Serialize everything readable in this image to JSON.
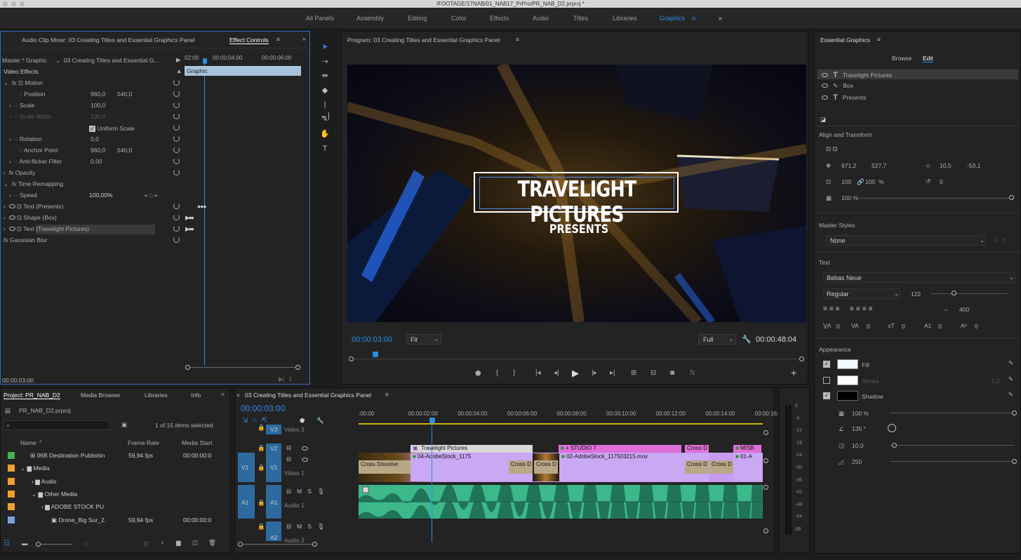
{
  "titlebar": {
    "title": "/FOOTAGE/17NAB/01_NAB17_PrPro/PR_NAB_D2.prproj *"
  },
  "workspaces": [
    "All Panels",
    "Assembly",
    "Editing",
    "Color",
    "Effects",
    "Audio",
    "Titles",
    "Libraries",
    "Graphics"
  ],
  "active_workspace": "Graphics",
  "effect_controls": {
    "tab_audio_mixer": "Audio Clip Mixer: 03 Creating Titles and Essential Graphics Panel",
    "tab_effect_controls": "Effect Controls",
    "master": "Master * Graphic",
    "sequence": "03 Creating Titles and Essential G...",
    "ruler": [
      "02:00",
      "00:00:04:00",
      "00:00:06:00"
    ],
    "graphic_label": "Graphic",
    "video_effects": "Video Effects",
    "motion": "Motion",
    "position_label": "Position",
    "position_x": "960,0",
    "position_y": "540,0",
    "scale_label": "Scale",
    "scale": "100,0",
    "scale_width_label": "Scale Width",
    "scale_width": "100,0",
    "uniform_scale": "Uniform Scale",
    "rotation_label": "Rotation",
    "rotation": "0,0",
    "anchor_label": "Anchor Point",
    "anchor_x": "960,0",
    "anchor_y": "540,0",
    "antiflicker_label": "Anti-flicker Filter",
    "antiflicker": "0,00",
    "opacity": "Opacity",
    "time_remapping": "Time Remapping",
    "speed_label": "Speed",
    "speed": "100,00%",
    "text_presents": "Text (Presents)",
    "shape_box": "Shape (Box)",
    "text_travelight": "Text (Travelight Pictures)",
    "gaussian_blur": "Gaussian Blur",
    "timecode": "00:00:03:00"
  },
  "program": {
    "title": "Program: 03 Creating Titles and Essential Graphics Panel",
    "video_title": "TRAVELIGHT PICTURES",
    "video_subtitle": "PRESENTS",
    "timecode": "00:00:03:00",
    "fit": "Fit",
    "full": "Full",
    "duration": "00:00:48:04"
  },
  "essential_graphics": {
    "title": "Essential Graphics",
    "tab_browse": "Browse",
    "tab_edit": "Edit",
    "layers": [
      "Travelight Pictures",
      "Box",
      "Presents"
    ],
    "align_transform": "Align and Transform",
    "pos_x": "971,2",
    "pos_y": "527,7",
    "anchor_x": "10,5",
    "anchor_y": "-53,1",
    "scale_w": "100",
    "scale_h": "100",
    "scale_unit": "%",
    "rotation": "0",
    "opacity": "100 %",
    "master_styles": "Master Styles",
    "master_style_value": "None",
    "text": "Text",
    "font": "Bebas Neue",
    "font_style": "Regular",
    "font_size": "122",
    "tracking": "400",
    "kerning": "0",
    "leading": "0",
    "baseline": "0",
    "tsume": "0",
    "caps": "0",
    "appearance": "Appearance",
    "fill": "Fill",
    "stroke": "Stroke",
    "stroke_value": "1,0",
    "shadow": "Shadow",
    "shadow_opacity": "100 %",
    "shadow_angle": "135 °",
    "shadow_distance": "10,0",
    "shadow_size": "250"
  },
  "project": {
    "tabs": [
      "Project: PR_NAB_D2",
      "Media Browser",
      "Libraries",
      "Info"
    ],
    "file": "PR_NAB_D2.prproj",
    "selected": "1 of 15 items selected",
    "columns": [
      "Name",
      "Frame Rate",
      "Media Start"
    ],
    "rows": [
      {
        "name": "06B Destination Publishin",
        "rate": "59,94 fps",
        "start": "00:00:00:0",
        "color": "#4caf50"
      },
      {
        "name": "Media",
        "rate": "",
        "start": "",
        "color": "#f0a030"
      },
      {
        "name": "Audio",
        "rate": "",
        "start": "",
        "color": "#f0a030"
      },
      {
        "name": "Other Media",
        "rate": "",
        "start": "",
        "color": "#f0a030"
      },
      {
        "name": "ADOBE STOCK PU",
        "rate": "",
        "start": "",
        "color": "#f0a030"
      },
      {
        "name": "Drone_Big Sur_2.",
        "rate": "59,94 fps",
        "start": "00:00:00:0",
        "color": "#7aa0d8"
      }
    ]
  },
  "timeline": {
    "title": "03 Creating Titles and Essential Graphics Panel",
    "timecode": "00:00:03:00",
    "ruler": [
      ":00:00",
      "00:00:02:00",
      "00:00:04:00",
      "00:00:06:00",
      "00:00:08:00",
      "00:00:10:00",
      "00:00:12:00",
      "00:00:14:00",
      "00:00:16:"
    ],
    "tracks": [
      "Video 3",
      "V2",
      "V1",
      "Video 1",
      "A1",
      "Audio 1",
      "A2",
      "Audio 2"
    ],
    "clips": {
      "travelight": "Travelight Pictures",
      "stock1": "04-AdobeStock_1175",
      "studio7": "+ STUDIO 7",
      "stock2": "02-AdobeStock_117503215.mov",
      "cross_dissolve": "Cross Dissolve",
      "cross_d": "Cross D",
      "misb": "MISB",
      "a01": "01-A"
    }
  },
  "meter": {
    "scale": [
      "0",
      "-6",
      "-12",
      "-18",
      "-24",
      "-30",
      "-36",
      "-42",
      "-48",
      "-54",
      "dB"
    ]
  }
}
